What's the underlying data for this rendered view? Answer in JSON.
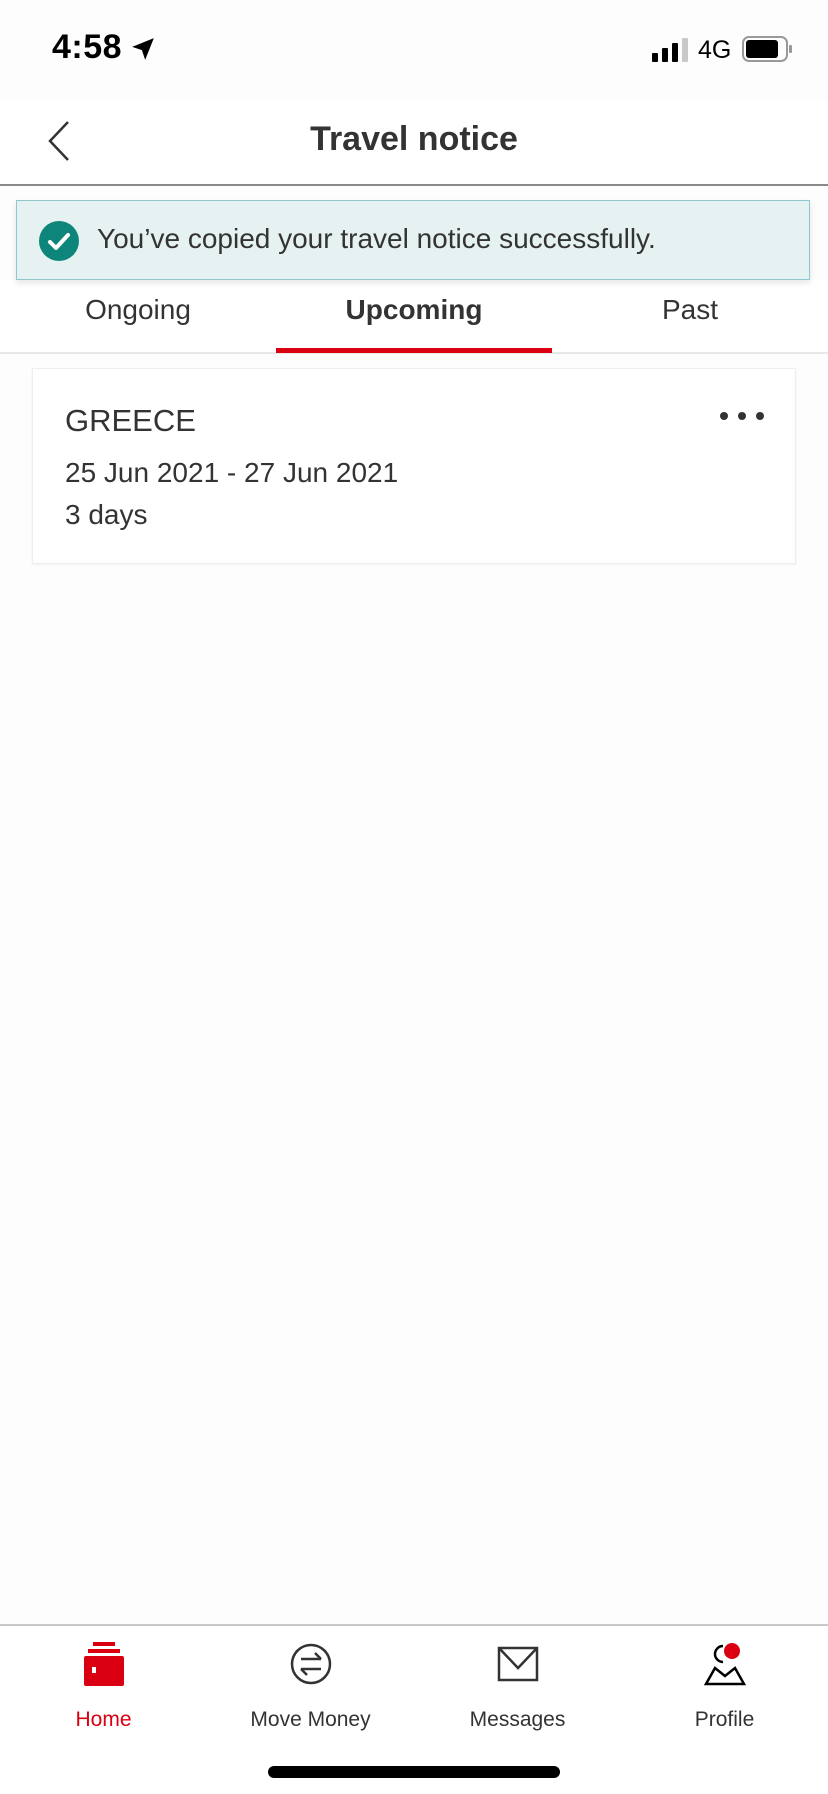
{
  "status_bar": {
    "time": "4:58",
    "network": "4G",
    "location_icon": "location-arrow-icon",
    "signal_icon": "signal-bars-icon",
    "battery_icon": "battery-icon"
  },
  "header": {
    "title": "Travel notice",
    "back_icon": "chevron-left-icon"
  },
  "banner": {
    "message": "You’ve copied your travel notice successfully.",
    "icon": "check-circle-icon",
    "color": "#0e857b"
  },
  "tabs": [
    {
      "label": "Ongoing",
      "active": false
    },
    {
      "label": "Upcoming",
      "active": true
    },
    {
      "label": "Past",
      "active": false
    }
  ],
  "notices": [
    {
      "country": "GREECE",
      "dates": "25 Jun 2021 - 27 Jun 2021",
      "duration": "3 days",
      "menu_icon": "more-horizontal-icon"
    }
  ],
  "bottom_nav": [
    {
      "label": "Home",
      "icon": "home-icon",
      "active": true
    },
    {
      "label": "Move Money",
      "icon": "transfer-icon",
      "active": false
    },
    {
      "label": "Messages",
      "icon": "envelope-icon",
      "active": false
    },
    {
      "label": "Profile",
      "icon": "profile-icon",
      "active": false,
      "badge": true
    }
  ],
  "colors": {
    "accent": "#db0011",
    "success": "#0e857b",
    "banner_bg": "#e6f1f1"
  }
}
